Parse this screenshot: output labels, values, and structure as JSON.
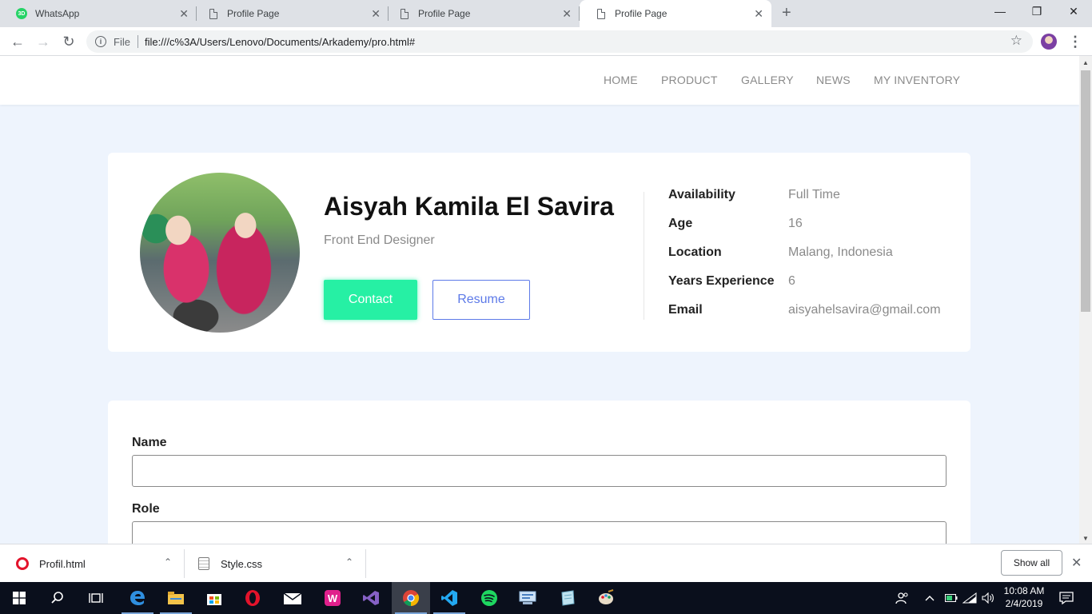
{
  "browser": {
    "tabs": [
      {
        "title": "WhatsApp",
        "icon": "whatsapp-icon"
      },
      {
        "title": "Profile Page",
        "icon": "document-icon"
      },
      {
        "title": "Profile Page",
        "icon": "document-icon"
      },
      {
        "title": "Profile Page",
        "icon": "document-icon",
        "active": true
      }
    ],
    "new_tab": "+",
    "window_controls": {
      "minimize": "—",
      "restore": "❐",
      "close": "✕"
    },
    "address_bar": {
      "scheme_label": "File",
      "url": "file:///c%3A/Users/Lenovo/Documents/Arkademy/pro.html#"
    }
  },
  "site": {
    "nav": [
      "HOME",
      "PRODUCT",
      "GALLERY",
      "NEWS",
      "MY INVENTORY"
    ],
    "profile": {
      "name": "Aisyah Kamila El Savira",
      "role": "Front End Designer",
      "contact_label": "Contact",
      "resume_label": "Resume",
      "details": [
        {
          "label": "Availability",
          "value": "Full Time"
        },
        {
          "label": "Age",
          "value": "16"
        },
        {
          "label": "Location",
          "value": "Malang, Indonesia"
        },
        {
          "label": "Years Experience",
          "value": "6"
        },
        {
          "label": "Email",
          "value": "aisyahelsavira@gmail.com"
        }
      ]
    },
    "form": {
      "fields": [
        {
          "label": "Name",
          "value": ""
        },
        {
          "label": "Role",
          "value": ""
        }
      ]
    }
  },
  "downloads": {
    "items": [
      {
        "name": "Profil.html",
        "icon": "opera-icon"
      },
      {
        "name": "Style.css",
        "icon": "css-file-icon"
      }
    ],
    "show_all_label": "Show all"
  },
  "taskbar": {
    "clock_time": "10:08 AM",
    "clock_date": "2/4/2019"
  },
  "colors": {
    "accent_green": "#26f0a4",
    "accent_blue": "#5d7ae8",
    "page_background": "#eef4fd"
  }
}
